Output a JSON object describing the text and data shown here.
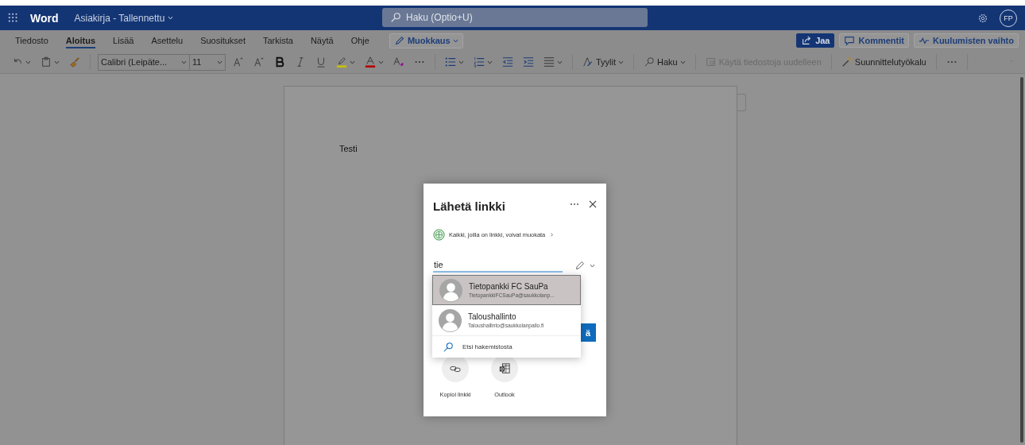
{
  "title_bar": {
    "app": "Word",
    "document": "Asiakirja - Tallennettu",
    "search_placeholder": "Haku (Optio+U)",
    "avatar": "FP"
  },
  "tabs": [
    {
      "label": "Tiedosto",
      "selected": false
    },
    {
      "label": "Aloitus",
      "selected": true
    },
    {
      "label": "Lisää",
      "selected": false
    },
    {
      "label": "Asettelu",
      "selected": false
    },
    {
      "label": "Suositukset",
      "selected": false
    },
    {
      "label": "Tarkista",
      "selected": false
    },
    {
      "label": "Näytä",
      "selected": false
    },
    {
      "label": "Ohje",
      "selected": false
    }
  ],
  "mode_button": "Muokkaus",
  "actions": [
    {
      "label": "Jaa",
      "kind": "primary"
    },
    {
      "label": "Kommentit",
      "kind": "comment"
    },
    {
      "label": "Kuulumisten vaihto",
      "kind": "activity"
    }
  ],
  "toolbar": {
    "font": "Calibri (Leipäte...",
    "size": "11",
    "labeled_buttons": [
      {
        "label": "Tyylit",
        "kind": "styles",
        "disabled": false
      },
      {
        "label": "Haku",
        "kind": "find",
        "disabled": false
      },
      {
        "label": "Käytä tiedostoja uudelleen",
        "kind": "reuse",
        "disabled": true
      },
      {
        "label": "Suunnittelutyökalu",
        "kind": "designer",
        "disabled": false
      }
    ]
  },
  "document": {
    "text": "Testi"
  },
  "dialog": {
    "title": "Lähetä linkki",
    "permission": "Kaikki, joilla on linkki, voivat muokata",
    "recipient_value": "tie",
    "send_button": "ä",
    "suggestions": [
      {
        "name": "Tietopankki FC SauPa",
        "email": "TietopankkiFCSauPa@saukkolanp...",
        "selected": true
      },
      {
        "name": "Taloushallinto",
        "email": "Taloushallinto@saukkolanpallo.fi",
        "selected": false
      }
    ],
    "directory_search": "Etsi hakemistosta",
    "share_options": [
      {
        "label": "Kopioi linkki",
        "kind": "copy"
      },
      {
        "label": "Outlook",
        "kind": "outlook"
      }
    ]
  }
}
